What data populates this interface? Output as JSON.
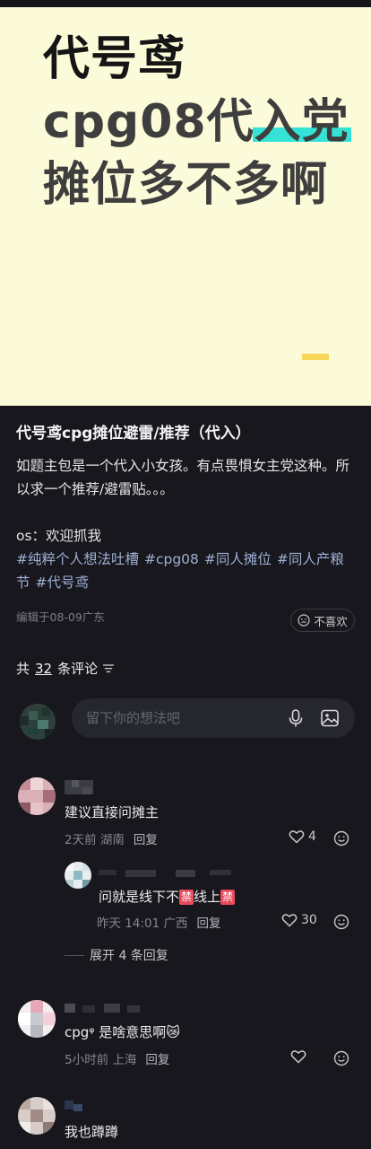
{
  "cover": {
    "line1": "代号鸢",
    "line2_plain": "cpg08代",
    "line2_highlight": "入党",
    "line3": "摊位多不多啊",
    "highlight_color": "#35e3d6",
    "background": "#fcfbd9"
  },
  "post": {
    "title": "代号鸢cpg摊位避雷/推荐（代入）",
    "body": "如题主包是一个代入小女孩。有点畏惧女主党这种。所以求一个推荐/避雷贴。。。",
    "os": "os：欢迎抓我",
    "tags": [
      "#纯粹个人想法吐槽",
      "#cpg08",
      "#同人摊位",
      "#同人产粮节",
      "#代号鸢"
    ],
    "meta": "编辑于08-09广东",
    "dislike_label": "不喜欢"
  },
  "comments_header": {
    "prefix": "共",
    "count": "32",
    "suffix": "条评论",
    "sort_icon": "sort-lines-icon"
  },
  "composer": {
    "placeholder": "留下你的想法吧",
    "mic_icon": "microphone-icon",
    "image_icon": "image-icon"
  },
  "comments": [
    {
      "text": "建议直接问摊主",
      "time_loc": "2天前 湖南",
      "reply_label": "回复",
      "likes": "4"
    },
    {
      "text_a": "问就是线下不",
      "ban1": "禁",
      "text_b": "线上",
      "ban2": "禁",
      "time_loc": "昨天 14:01 广西",
      "reply_label": "回复",
      "likes": "30"
    },
    {
      "text": "cpgᵠ 是啥意思啊😿",
      "time_loc": "5小时前 上海",
      "reply_label": "回复",
      "likes": ""
    },
    {
      "text": "我也蹲蹲"
    }
  ],
  "expand_label": "展开 4 条回复"
}
